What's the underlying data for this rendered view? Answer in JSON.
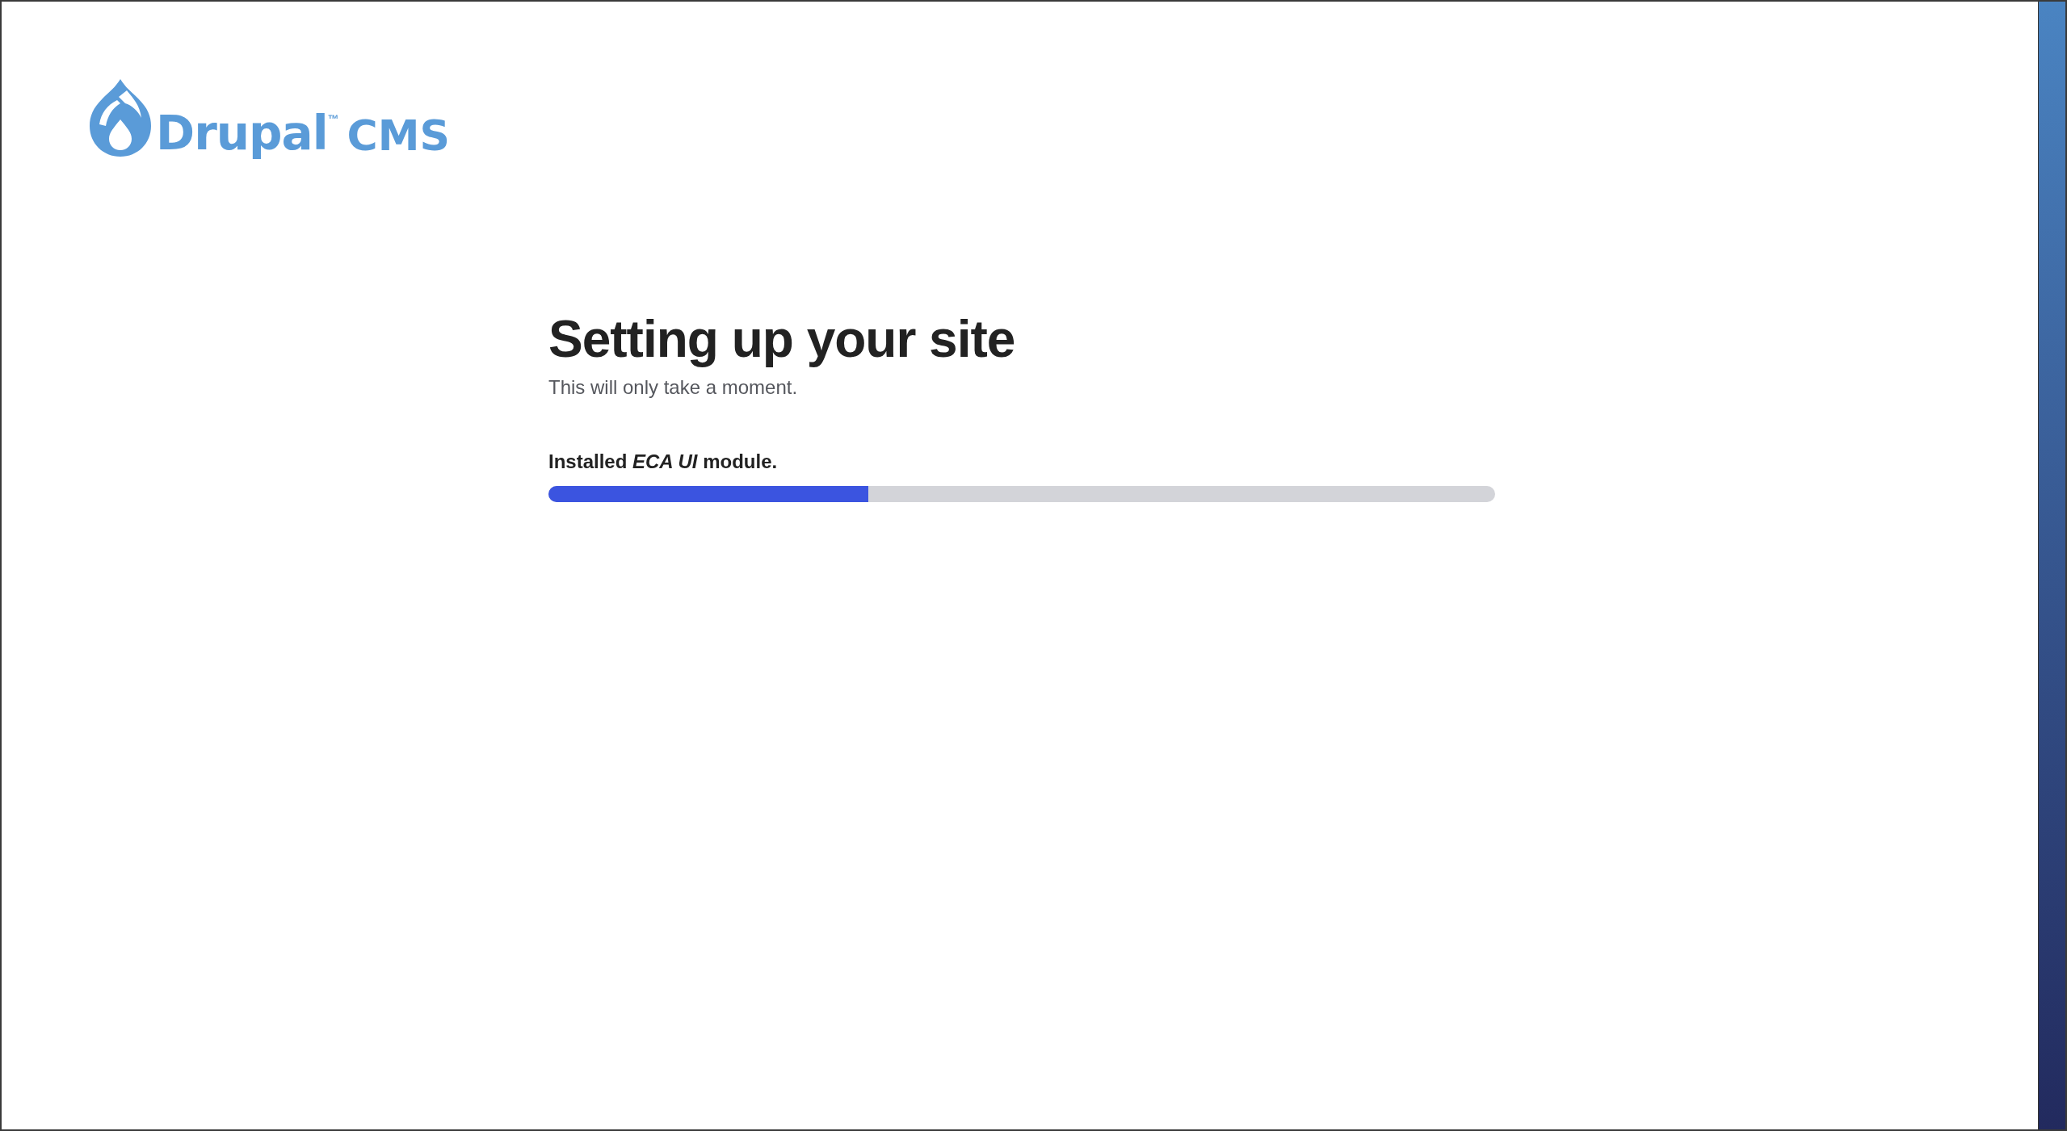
{
  "logo": {
    "name": "Drupal",
    "mark": "™",
    "product": "CMS"
  },
  "heading": "Setting up your site",
  "subtitle": "This will only take a moment.",
  "progress": {
    "label": "Installed *ECA UI* module.",
    "level": 0.338
  }
}
